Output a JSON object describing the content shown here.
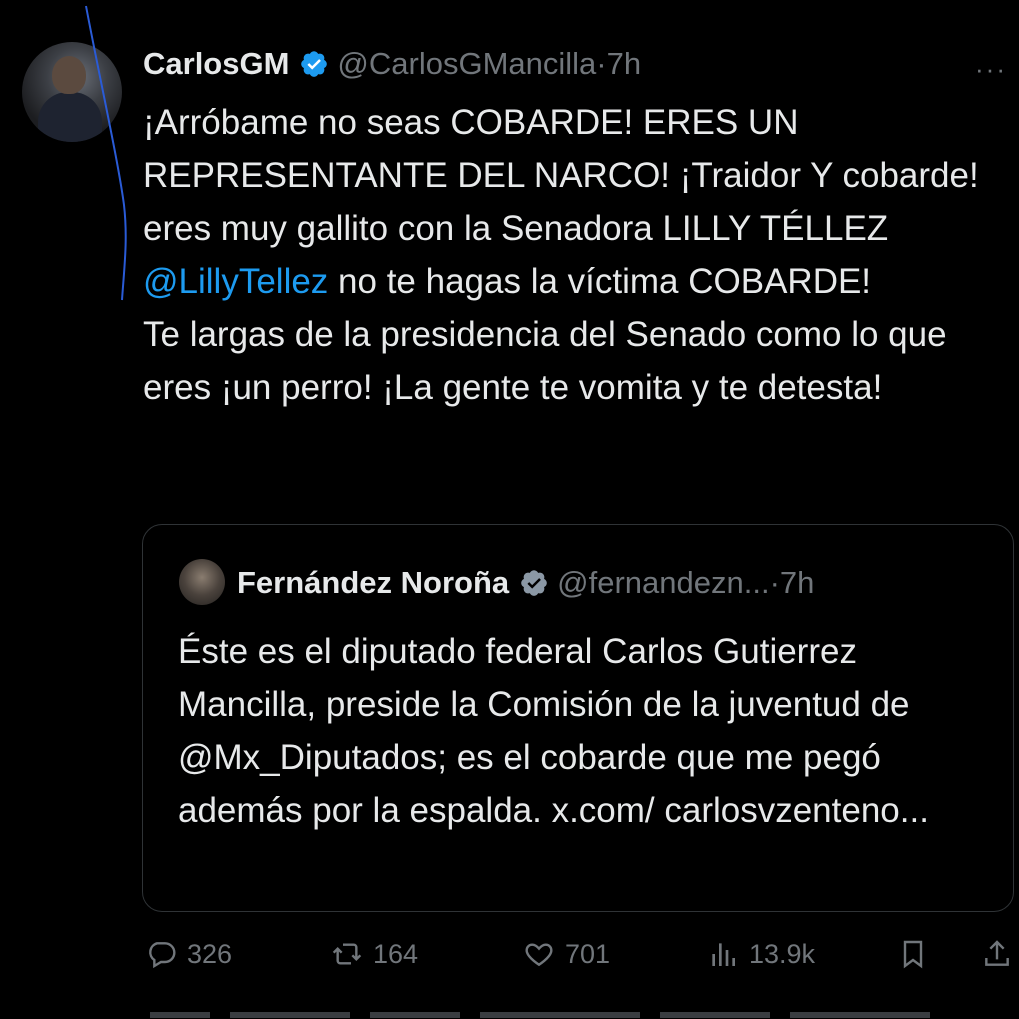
{
  "tweet": {
    "author_name": "CarlosGM",
    "author_handle": "@CarlosGMancilla",
    "separator": "·",
    "time": "7h",
    "text_part1": "¡Arróbame no seas COBARDE! ERES UN REPRESENTANTE DEL NARCO! ¡Traidor Y cobarde! eres muy gallito con la Senadora LILLY TÉLLEZ ",
    "mention": "@LillyTellez",
    "text_part2": " no te hagas la víctima COBARDE!",
    "text_part3": "Te largas de la presidencia del Senado como lo que eres ¡un perro! ¡La gente te vomita y te detesta!"
  },
  "quote": {
    "author_name": "Fernández Noroña",
    "author_handle": "@fernandezn...",
    "separator": "·",
    "time": "7h",
    "text": "Éste es el diputado federal Carlos Gutierrez Mancilla, preside la Comisión de la juventud de @Mx_Diputados; es el cobarde que me pegó además por la espalda. x.com/ carlosvzenteno..."
  },
  "actions": {
    "replies": "326",
    "reposts": "164",
    "likes": "701",
    "views": "13.9k"
  },
  "icons": {
    "more": "more-icon",
    "verified": "verified-badge-icon",
    "reply": "reply-icon",
    "repost": "repost-icon",
    "like": "heart-icon",
    "views": "views-icon",
    "bookmark": "bookmark-icon",
    "share": "share-icon"
  },
  "colors": {
    "background": "#000000",
    "text": "#e7e9ea",
    "muted": "#71767b",
    "link": "#1d9bf0",
    "verified": "#1d9bf0",
    "border": "#2f3336"
  }
}
